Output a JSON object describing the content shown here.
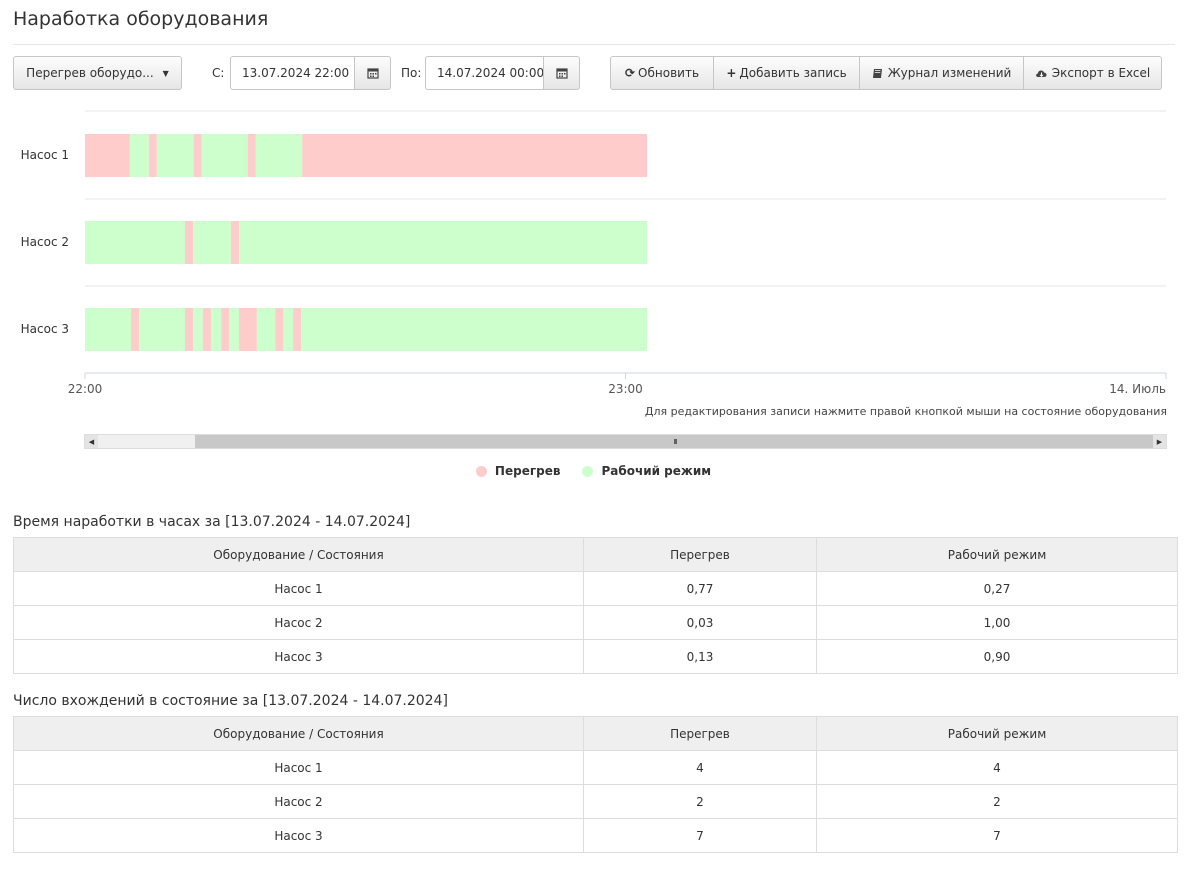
{
  "page": {
    "title": "Наработка оборудования"
  },
  "toolbar": {
    "dropdown_label": "Перегрев оборудо...",
    "from_label": "С:",
    "from_value": "13.07.2024 22:00",
    "to_label": "По:",
    "to_value": "14.07.2024 00:00",
    "refresh_label": "Обновить",
    "add_label": "Добавить запись",
    "journal_label": "Журнал изменений",
    "export_label": "Экспорт в Excel"
  },
  "chart_data": {
    "type": "timeline",
    "rows": [
      "Насос 1",
      "Насос 2",
      "Насос 3"
    ],
    "x_ticks": [
      "22:00",
      "23:00",
      "14. Июль"
    ],
    "x_range_hours": [
      22.0,
      24.0
    ],
    "data_end_hours": 23.04,
    "segments": [
      [
        {
          "s": 22.0,
          "e": 22.083,
          "state": "Перегрев"
        },
        {
          "s": 22.083,
          "e": 22.118,
          "state": "Рабочий режим"
        },
        {
          "s": 22.118,
          "e": 22.133,
          "state": "Перегрев"
        },
        {
          "s": 22.133,
          "e": 22.201,
          "state": "Рабочий режим"
        },
        {
          "s": 22.201,
          "e": 22.216,
          "state": "Перегрев"
        },
        {
          "s": 22.216,
          "e": 22.301,
          "state": "Рабочий режим"
        },
        {
          "s": 22.301,
          "e": 22.316,
          "state": "Перегрев"
        },
        {
          "s": 22.316,
          "e": 22.402,
          "state": "Рабочий режим"
        },
        {
          "s": 22.402,
          "e": 23.04,
          "state": "Перегрев"
        }
      ],
      [
        {
          "s": 22.0,
          "e": 22.185,
          "state": "Рабочий режим"
        },
        {
          "s": 22.185,
          "e": 22.2,
          "state": "Перегрев"
        },
        {
          "s": 22.2,
          "e": 22.27,
          "state": "Рабочий режим"
        },
        {
          "s": 22.27,
          "e": 22.285,
          "state": "Перегрев"
        },
        {
          "s": 22.285,
          "e": 23.04,
          "state": "Рабочий режим"
        }
      ],
      [
        {
          "s": 22.0,
          "e": 22.085,
          "state": "Рабочий режим"
        },
        {
          "s": 22.085,
          "e": 22.1,
          "state": "Перегрев"
        },
        {
          "s": 22.1,
          "e": 22.185,
          "state": "Рабочий режим"
        },
        {
          "s": 22.185,
          "e": 22.2,
          "state": "Перегрев"
        },
        {
          "s": 22.2,
          "e": 22.218,
          "state": "Рабочий режим"
        },
        {
          "s": 22.218,
          "e": 22.233,
          "state": "Перегрев"
        },
        {
          "s": 22.233,
          "e": 22.252,
          "state": "Рабочий режим"
        },
        {
          "s": 22.252,
          "e": 22.267,
          "state": "Перегрев"
        },
        {
          "s": 22.267,
          "e": 22.285,
          "state": "Рабочий режим"
        },
        {
          "s": 22.285,
          "e": 22.318,
          "state": "Перегрев"
        },
        {
          "s": 22.318,
          "e": 22.352,
          "state": "Рабочий режим"
        },
        {
          "s": 22.352,
          "e": 22.367,
          "state": "Перегрев"
        },
        {
          "s": 22.367,
          "e": 22.385,
          "state": "Рабочий режим"
        },
        {
          "s": 22.385,
          "e": 22.4,
          "state": "Перегрев"
        },
        {
          "s": 22.4,
          "e": 23.04,
          "state": "Рабочий режим"
        }
      ]
    ],
    "legend": [
      {
        "name": "Перегрев",
        "color": "#ffcccc"
      },
      {
        "name": "Рабочий режим",
        "color": "#ccffcc"
      }
    ]
  },
  "chart_hint": "Для редактирования записи нажмите правой кнопкой мыши на состояние оборудования",
  "hours_table": {
    "title": "Время наработки в часах за [13.07.2024 - 14.07.2024]",
    "headers": [
      "Оборудование / Состояния",
      "Перегрев",
      "Рабочий режим"
    ],
    "rows": [
      [
        "Насос 1",
        "0,77",
        "0,27"
      ],
      [
        "Насос 2",
        "0,03",
        "1,00"
      ],
      [
        "Насос 3",
        "0,13",
        "0,90"
      ]
    ]
  },
  "count_table": {
    "title": "Число вхождений в состояние за [13.07.2024 - 14.07.2024]",
    "headers": [
      "Оборудование / Состояния",
      "Перегрев",
      "Рабочий режим"
    ],
    "rows": [
      [
        "Насос 1",
        "4",
        "4"
      ],
      [
        "Насос 2",
        "2",
        "2"
      ],
      [
        "Насос 3",
        "7",
        "7"
      ]
    ]
  }
}
